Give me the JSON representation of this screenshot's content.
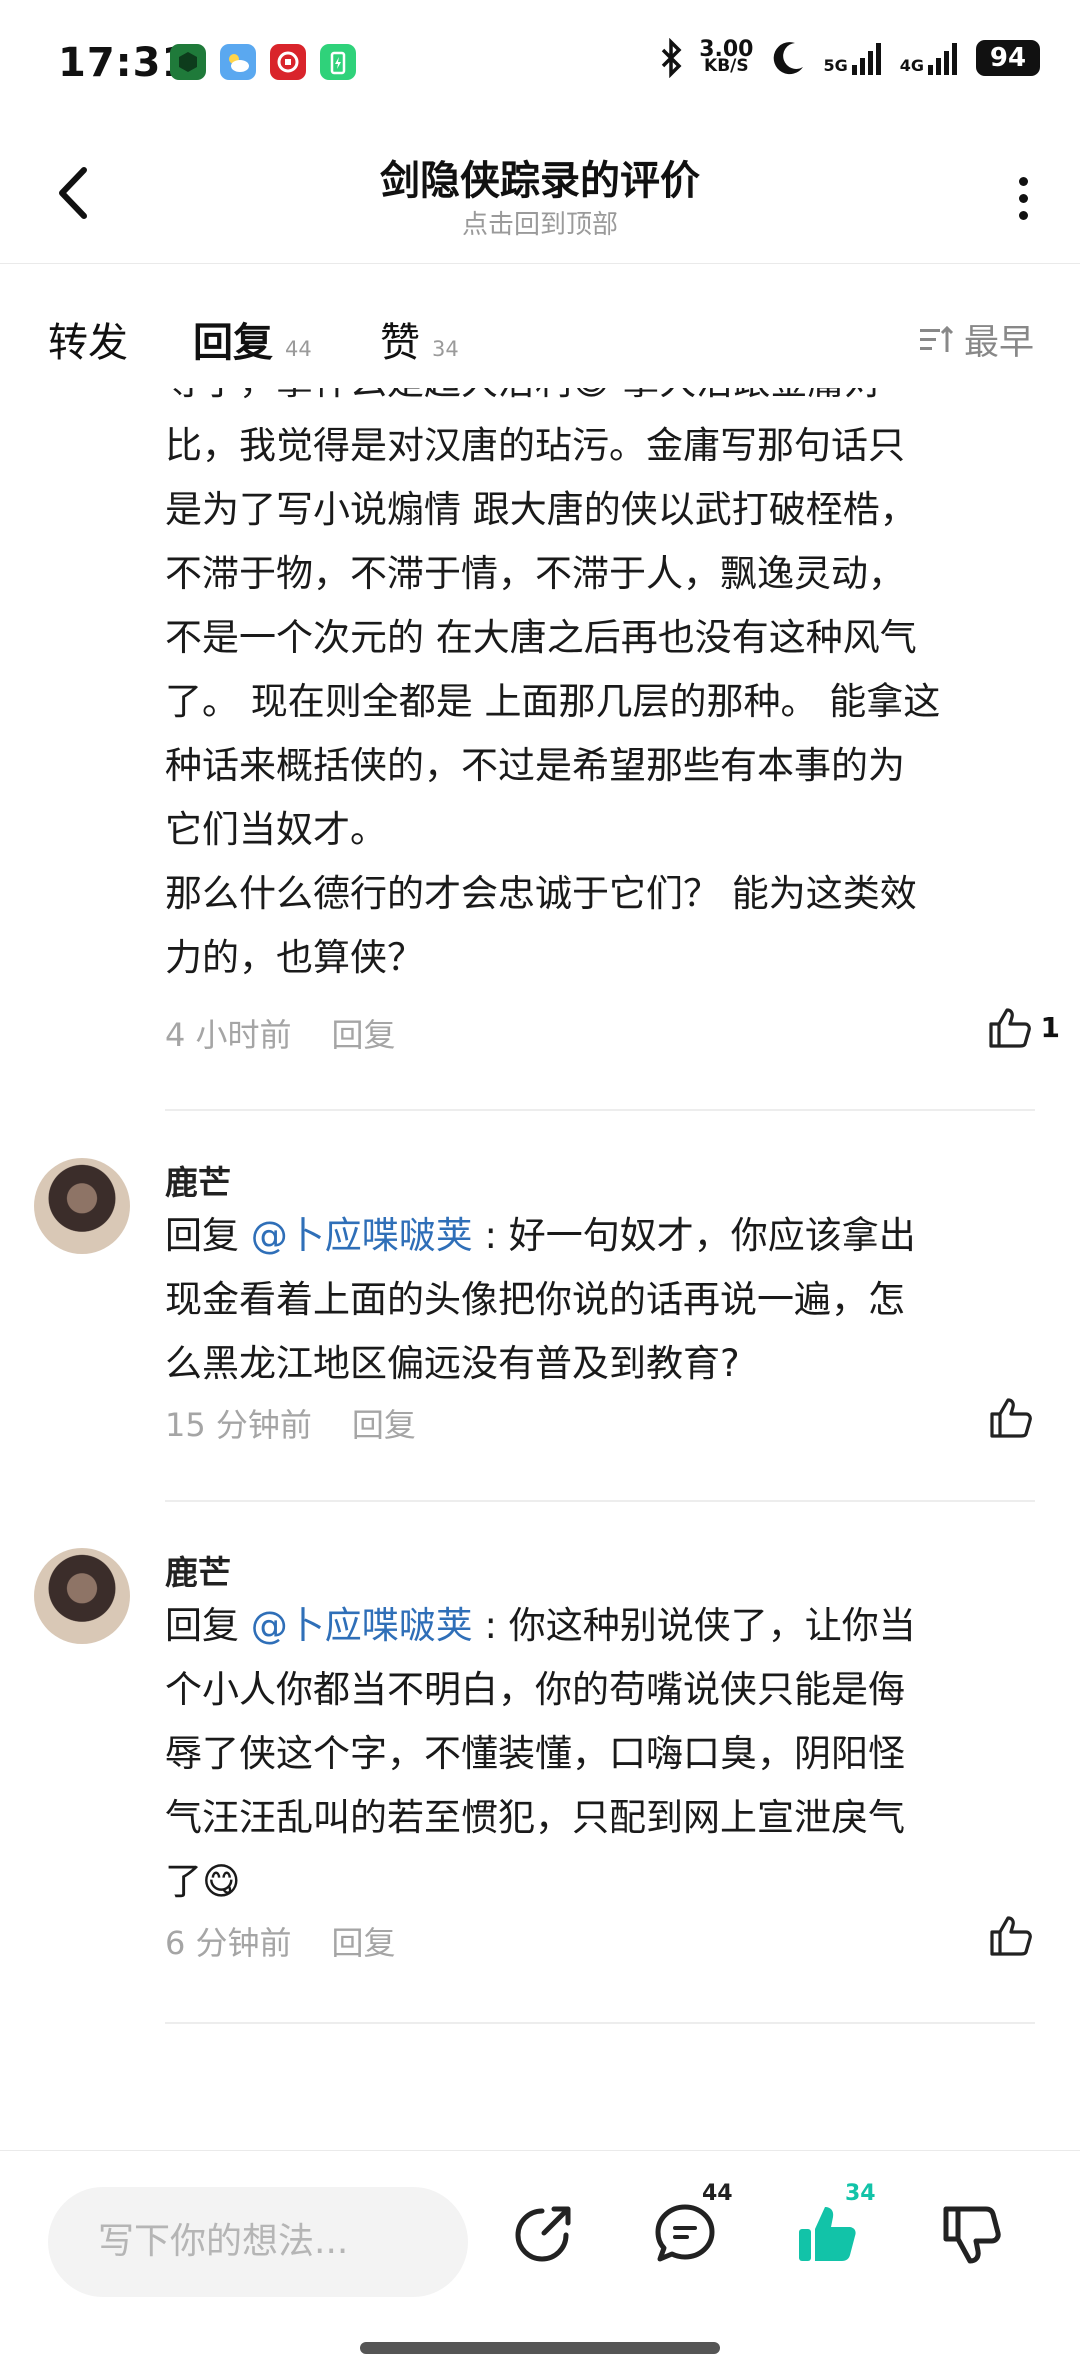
{
  "status_bar": {
    "time": "17:31",
    "speed_value": "3.00",
    "speed_unit": "KB/S",
    "net1": "5G",
    "net2": "4G",
    "battery": "94",
    "icons": [
      "app-green-icon",
      "weather-icon",
      "app-red-icon",
      "app-battery-green-icon",
      "bluetooth-icon",
      "moon-icon",
      "signal-icon"
    ]
  },
  "header": {
    "title": "剑隐侠踪录的评价",
    "subtitle": "点击回到顶部"
  },
  "tabs": [
    {
      "label": "转发"
    },
    {
      "label": "回复",
      "count": "44"
    },
    {
      "label": "赞",
      "count": "34"
    }
  ],
  "sort_label": "最早",
  "comments": [
    {
      "partial_top_line": "等了，拿什么是超大治利😄 拿大治跟金庸对",
      "lines": [
        "比，我觉得是对汉唐的玷污。金庸写那句话只",
        "是为了写小说煽情 跟大唐的侠以武打破桎梏，",
        "不滞于物，不滞于情，不滞于人，飘逸灵动，",
        "不是一个次元的 在大唐之后再也没有这种风气",
        "了。 现在则全都是 上面那几层的那种。 能拿这",
        "种话来概括侠的，不过是希望那些有本事的为",
        "它们当奴才。",
        "那么什么德行的才会忠诚于它们？ 能为这类效",
        "力的，也算侠？"
      ],
      "time": "4 小时前",
      "reply_label": "回复",
      "likes": "1"
    },
    {
      "username": "鹿芒",
      "reply_prefix": "回复 ",
      "mention": "@卜应喋啵荚",
      "text_first": " : 好一句奴才，你应该拿出",
      "lines": [
        "现金看着上面的头像把你说的话再说一遍，怎",
        "么黑龙江地区偏远没有普及到教育?"
      ],
      "time": "15 分钟前",
      "reply_label": "回复"
    },
    {
      "username": "鹿芒",
      "reply_prefix": "回复 ",
      "mention": "@卜应喋啵荚",
      "text_first": " : 你这种别说侠了，让你当",
      "lines": [
        "个小人你都当不明白，你的苟嘴说侠只能是侮",
        "辱了侠这个字，不懂装懂，口嗨口臭，阴阳怪",
        "气汪汪乱叫的若至惯犯，只配到网上宣泄戾气",
        "了😋"
      ],
      "time": "6 分钟前",
      "reply_label": "回复"
    }
  ],
  "bottom_bar": {
    "placeholder": "写下你的想法...",
    "comment_count": "44",
    "like_count": "34"
  }
}
